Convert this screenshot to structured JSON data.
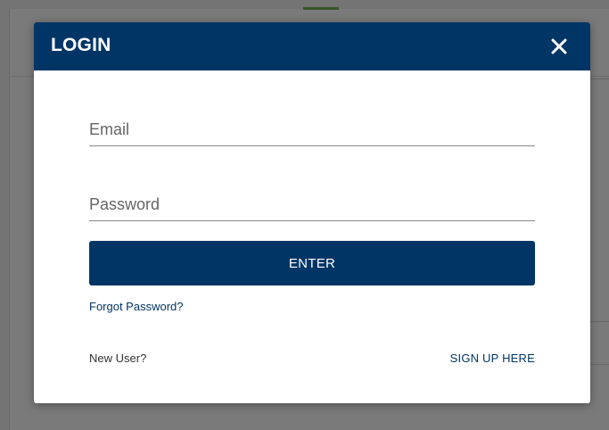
{
  "modal": {
    "title": "LOGIN",
    "close_icon": "close-icon",
    "email": {
      "placeholder": "Email",
      "value": ""
    },
    "password": {
      "placeholder": "Password",
      "value": ""
    },
    "enter_label": "ENTER",
    "forgot_label": "Forgot Password?",
    "new_user_label": "New User?",
    "signup_label": "SIGN UP HERE"
  },
  "colors": {
    "brand_navy": "#013566",
    "overlay": "rgba(0,0,0,0.5)",
    "text_dark": "#333333"
  }
}
